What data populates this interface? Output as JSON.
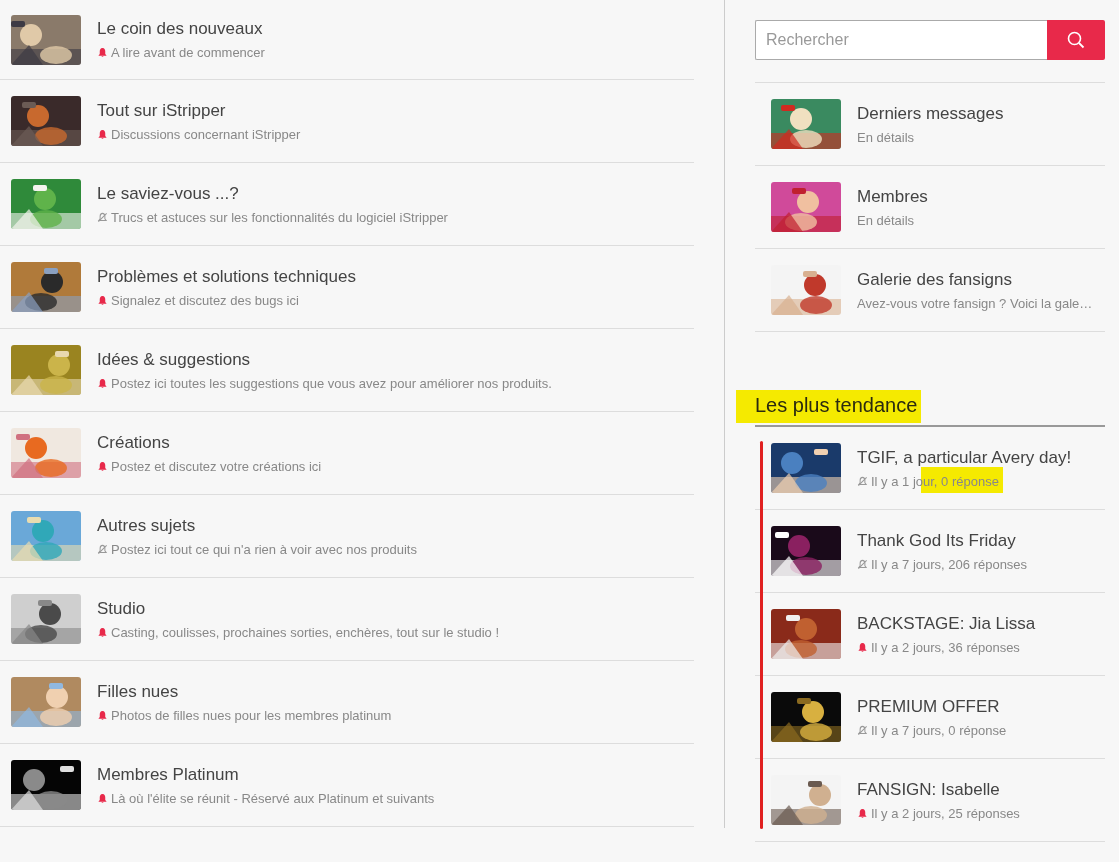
{
  "forums": [
    {
      "title": "Le coin des nouveaux",
      "description": "A lire avant de commencer",
      "notify": true
    },
    {
      "title": "Tout sur iStripper",
      "description": "Discussions concernant iStripper",
      "notify": true
    },
    {
      "title": "Le saviez-vous ...?",
      "description": "Trucs et astuces sur les fonctionnalités du logiciel iStripper",
      "notify": false
    },
    {
      "title": "Problèmes et solutions techniques",
      "description": "Signalez et discutez des bugs ici",
      "notify": true
    },
    {
      "title": "Idées & suggestions",
      "description": "Postez ici toutes les suggestions que vous avez pour améliorer nos produits.",
      "notify": true
    },
    {
      "title": "Créations",
      "description": "Postez et discutez votre créations ici",
      "notify": true
    },
    {
      "title": "Autres sujets",
      "description": "Postez ici tout ce qui n'a rien à voir avec nos produits",
      "notify": false
    },
    {
      "title": "Studio",
      "description": "Casting, coulisses, prochaines sorties, enchères, tout sur le studio !",
      "notify": true
    },
    {
      "title": "Filles nues",
      "description": "Photos de filles nues pour les membres platinum",
      "notify": true
    },
    {
      "title": "Membres Platinum",
      "description": "Là où l'élite se réunit - Réservé aux Platinum et suivants",
      "notify": true
    }
  ],
  "search": {
    "placeholder": "Rechercher"
  },
  "links": [
    {
      "title": "Derniers messages",
      "description": "En détails"
    },
    {
      "title": "Membres",
      "description": "En détails"
    },
    {
      "title": "Galerie des fansigns",
      "description": "Avez-vous votre fansign ? Voici la gale…"
    }
  ],
  "trending": {
    "heading": "Les plus tendance",
    "heading_highlighted": true,
    "bracket_line": true,
    "topics": [
      {
        "title": "TGIF, a particular Avery day!",
        "meta": "Il y a 1 jour, 0 réponse",
        "notify": false,
        "meta_highlighted": true
      },
      {
        "title": "Thank God Its Friday",
        "meta": "Il y a 7 jours, 206 réponses",
        "notify": false,
        "meta_highlighted": false
      },
      {
        "title": "BACKSTAGE: Jia Lissa",
        "meta": "Il y a 2 jours, 36 réponses",
        "notify": true,
        "meta_highlighted": false
      },
      {
        "title": "PREMIUM OFFER",
        "meta": "Il y a 7 jours, 0 réponse",
        "notify": false,
        "meta_highlighted": false
      },
      {
        "title": "FANSIGN: Isabelle",
        "meta": "Il y a 2 jours, 25 réponses",
        "notify": true,
        "meta_highlighted": false
      }
    ]
  }
}
